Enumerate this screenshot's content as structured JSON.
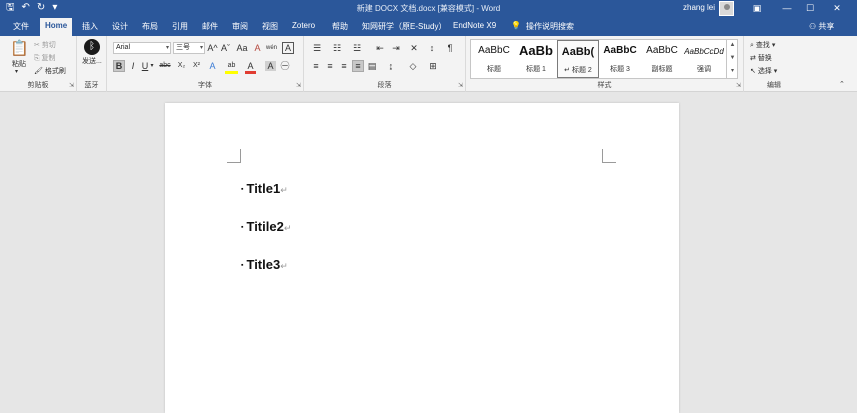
{
  "window": {
    "title": "新建 DOCX 文档.docx [兼容模式] - Word",
    "user": "zhang lei",
    "min_glyph": "—",
    "restore_glyph": "☐",
    "close_glyph": "✕",
    "qat_save_glyph": "🖫",
    "qat_undo_glyph": "↶",
    "qat_redo_glyph": "↻",
    "qat_more_glyph": "▾"
  },
  "tabs": [
    {
      "label": "文件"
    },
    {
      "label": "Home"
    },
    {
      "label": "插入"
    },
    {
      "label": "设计"
    },
    {
      "label": "布局"
    },
    {
      "label": "引用"
    },
    {
      "label": "邮件"
    },
    {
      "label": "审阅"
    },
    {
      "label": "视图"
    },
    {
      "label": "Zotero"
    },
    {
      "label": "帮助"
    },
    {
      "label": "知网研学（原E-Study）"
    },
    {
      "label": "EndNote X9"
    },
    {
      "label": "操作说明搜索"
    }
  ],
  "share_label": "共享",
  "clipboard": {
    "paste": "粘贴",
    "cut": "剪切",
    "copy": "复制",
    "format_painter": "格式刷",
    "label": "剪贴板"
  },
  "bluetooth": {
    "send": "发送...",
    "label": "蓝牙"
  },
  "font": {
    "name": "Arial",
    "size": "三号",
    "label": "字体",
    "bold": "B",
    "italic": "I",
    "underline": "U",
    "strike": "abc",
    "sub": "X₂",
    "sup": "X²",
    "grow": "A^",
    "shrink": "Aˇ",
    "case": "Aa",
    "clear": "A",
    "phonetic": "wén",
    "border": "A",
    "effects": "A",
    "highlight": "ab",
    "color": "A",
    "shade": "A",
    "circle": "㊀"
  },
  "paragraph": {
    "label": "段落"
  },
  "styles": {
    "label": "样式",
    "items": [
      {
        "preview": "AaBbC",
        "name": "标题"
      },
      {
        "preview": "AaBb",
        "name": "标题 1"
      },
      {
        "preview": "AaBb(",
        "name": "↵ 标题 2"
      },
      {
        "preview": "AaBbC",
        "name": "标题 3"
      },
      {
        "preview": "AaBbC",
        "name": "副标题"
      },
      {
        "preview": "AaBbCcDd",
        "name": "强调"
      }
    ]
  },
  "editing": {
    "find": "查找",
    "replace": "替换",
    "select": "选择",
    "label": "编辑"
  },
  "document": {
    "headings": [
      {
        "text": "Title1"
      },
      {
        "text": "Titile2"
      },
      {
        "text": "Title3"
      }
    ],
    "paragraph_mark": "↵",
    "bullet": "▪"
  },
  "colors": {
    "accent": "#2b579a",
    "highlight": "#ffff00",
    "font_color": "#e03c31"
  }
}
